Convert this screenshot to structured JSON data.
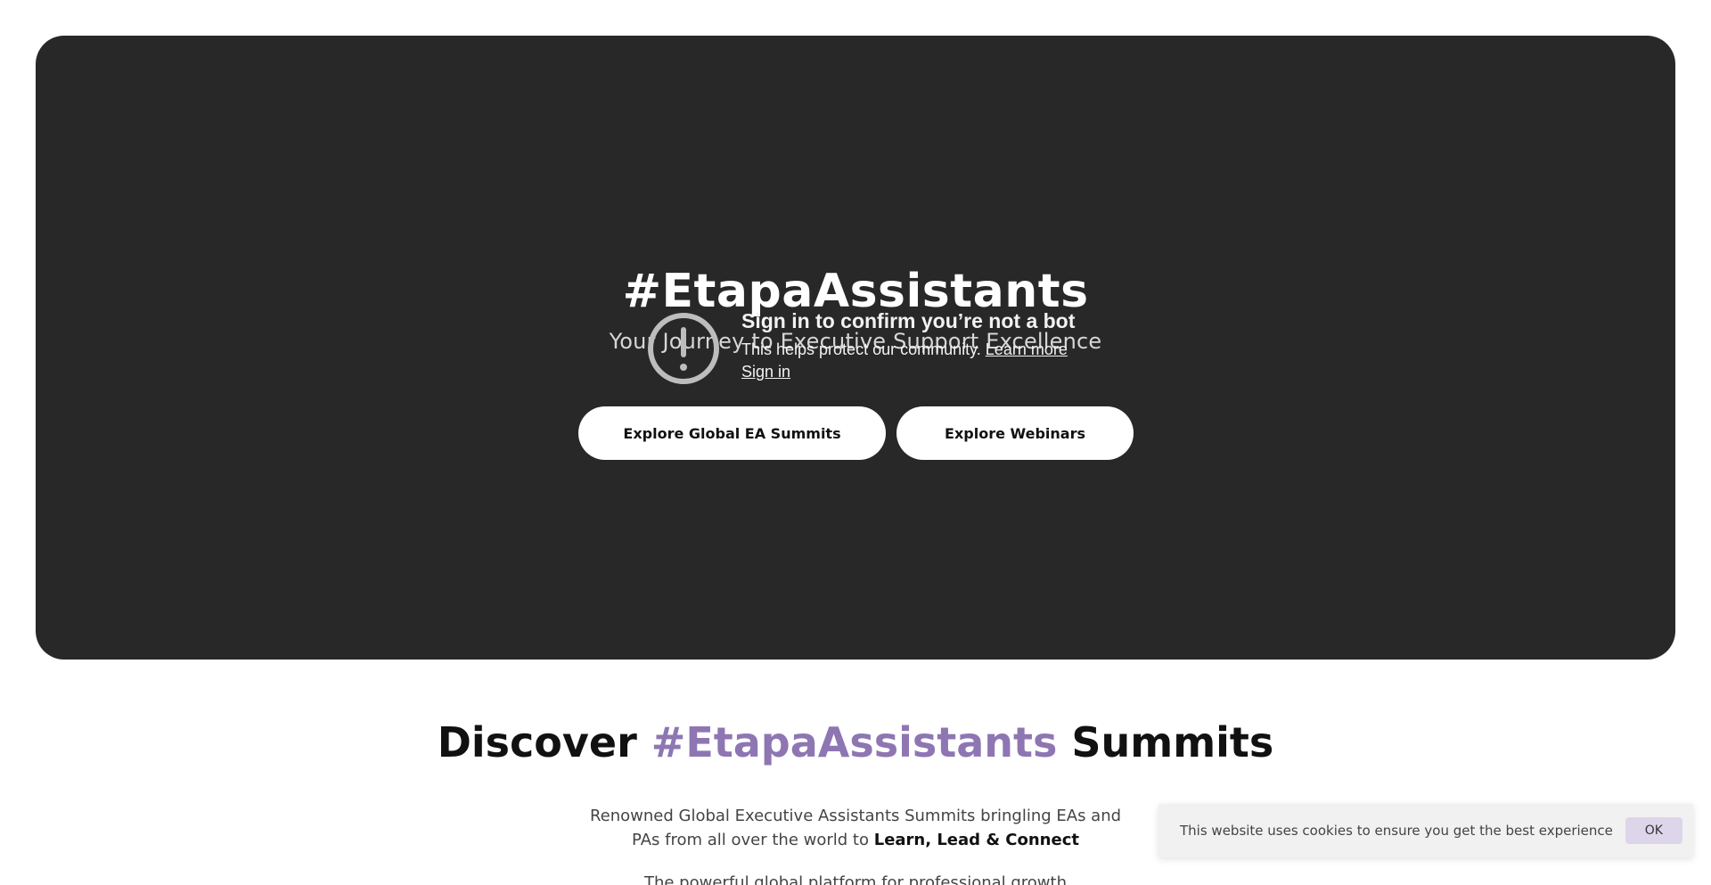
{
  "hero": {
    "title": "#EtapaAssistants",
    "subtitle": "Your Journey to Executive Support Excellence",
    "buttons": {
      "summits": "Explore Global EA Summits",
      "webinars": "Explore Webinars"
    },
    "bot_check": {
      "heading": "Sign in to confirm you’re not a bot",
      "text": "This helps protect our community.",
      "learn_more": "Learn more",
      "sign_in": "Sign in",
      "icon": "alert-circle-icon"
    }
  },
  "discover": {
    "prefix": "Discover ",
    "highlight": "#EtapaAssistants",
    "suffix": " Summits",
    "accent_color": "#8e76b3"
  },
  "description": {
    "line_part1": "Renowned Global Executive Assistants Summits bringling EAs and PAs from all over the world to ",
    "bold": "Learn, Lead & Connect",
    "next_line": "The powerful global platform for professional growth"
  },
  "cookie": {
    "text": "This website uses cookies to ensure you get the best experience",
    "ok": "OK"
  }
}
